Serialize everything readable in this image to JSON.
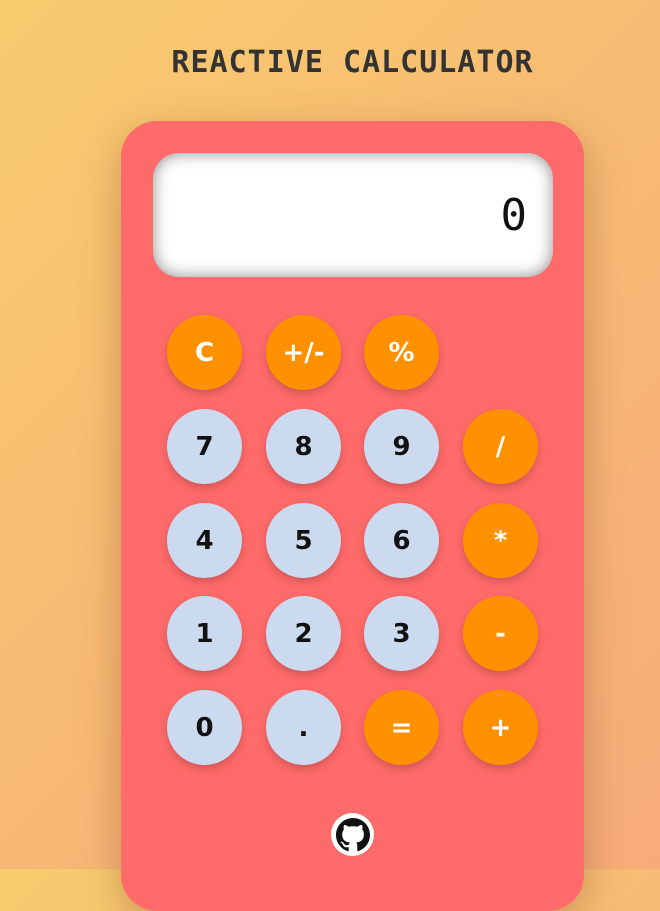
{
  "app": {
    "title": "REACTIVE CALCULATOR"
  },
  "display": {
    "value": "0"
  },
  "keys": {
    "clear": "C",
    "toggle_sign": "+/-",
    "percent": "%",
    "seven": "7",
    "eight": "8",
    "nine": "9",
    "divide": "/",
    "four": "4",
    "five": "5",
    "six": "6",
    "multiply": "*",
    "one": "1",
    "two": "2",
    "three": "3",
    "subtract": "-",
    "zero": "0",
    "decimal": ".",
    "equals": "=",
    "add": "+"
  },
  "footer": {
    "icon": "github-icon"
  },
  "colors": {
    "calculator_body": "#ff6a6a",
    "operator_key": "#ff9100",
    "number_key": "#ccdaf0",
    "display_bg": "#ffffff"
  }
}
